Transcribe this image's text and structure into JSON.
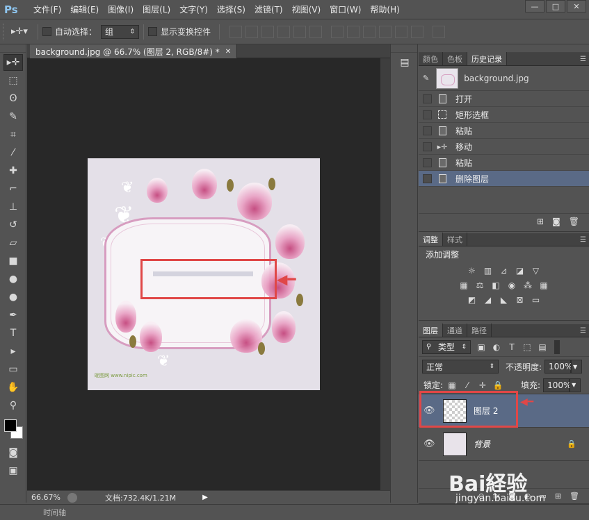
{
  "app": {
    "logo": "Ps"
  },
  "menu": [
    "文件(F)",
    "编辑(E)",
    "图像(I)",
    "图层(L)",
    "文字(Y)",
    "选择(S)",
    "滤镜(T)",
    "视图(V)",
    "窗口(W)",
    "帮助(H)"
  ],
  "window_controls": {
    "minimize": "—",
    "restore": "□",
    "close": "✕"
  },
  "options": {
    "auto_select_label": "自动选择：",
    "auto_select_value": "组",
    "show_transform_label": "显示变换控件"
  },
  "document": {
    "tab_title": "background.jpg @ 66.7% (图层 2, RGB/8#) *",
    "tab_close": "✕",
    "zoom": "66.67%",
    "doc_info": "文档:732.4K/1.21M",
    "image_watermark": "昵图网 www.nipic.com"
  },
  "timeline_label": "时间轴",
  "history_panel": {
    "tabs": [
      "颜色",
      "色板",
      "历史记录"
    ],
    "active_tab": 2,
    "snapshot_name": "background.jpg",
    "steps": [
      {
        "label": "打开",
        "icon": "document-icon"
      },
      {
        "label": "矩形选框",
        "icon": "marquee-icon"
      },
      {
        "label": "粘贴",
        "icon": "document-icon"
      },
      {
        "label": "移动",
        "icon": "move-icon"
      },
      {
        "label": "粘贴",
        "icon": "document-icon"
      },
      {
        "label": "删除图层",
        "icon": "document-icon"
      }
    ],
    "selected_step": 5
  },
  "adjust_panel": {
    "tabs": [
      "调整",
      "样式"
    ],
    "title": "添加调整"
  },
  "layers_panel": {
    "tabs": [
      "图层",
      "通道",
      "路径"
    ],
    "filter_kind": "类型",
    "blend_mode": "正常",
    "opacity_label": "不透明度:",
    "opacity_value": "100%",
    "lock_label": "锁定:",
    "fill_label": "填充:",
    "fill_value": "100%",
    "layers": [
      {
        "name": "图层 2",
        "selected": true
      },
      {
        "name": "背景",
        "selected": false,
        "locked": true
      }
    ]
  },
  "watermark": {
    "brand": "Bai経验",
    "url": "jingyan.baidu.com"
  },
  "colors": {
    "accent_selected": "#5a6a86",
    "annotation_red": "#e04747"
  }
}
